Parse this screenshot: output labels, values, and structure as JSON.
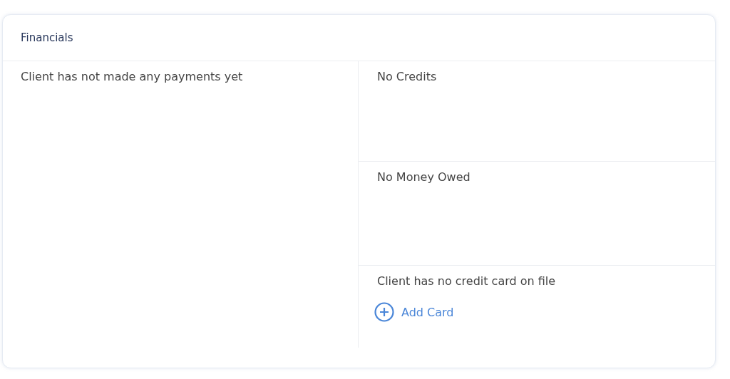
{
  "panel": {
    "title": "Financials"
  },
  "payments": {
    "message": "Client has not made any payments yet"
  },
  "credits": {
    "message": "No Credits"
  },
  "balance": {
    "message": "No Money Owed"
  },
  "card": {
    "message": "Client has no credit card on file",
    "action": "Add Card"
  }
}
